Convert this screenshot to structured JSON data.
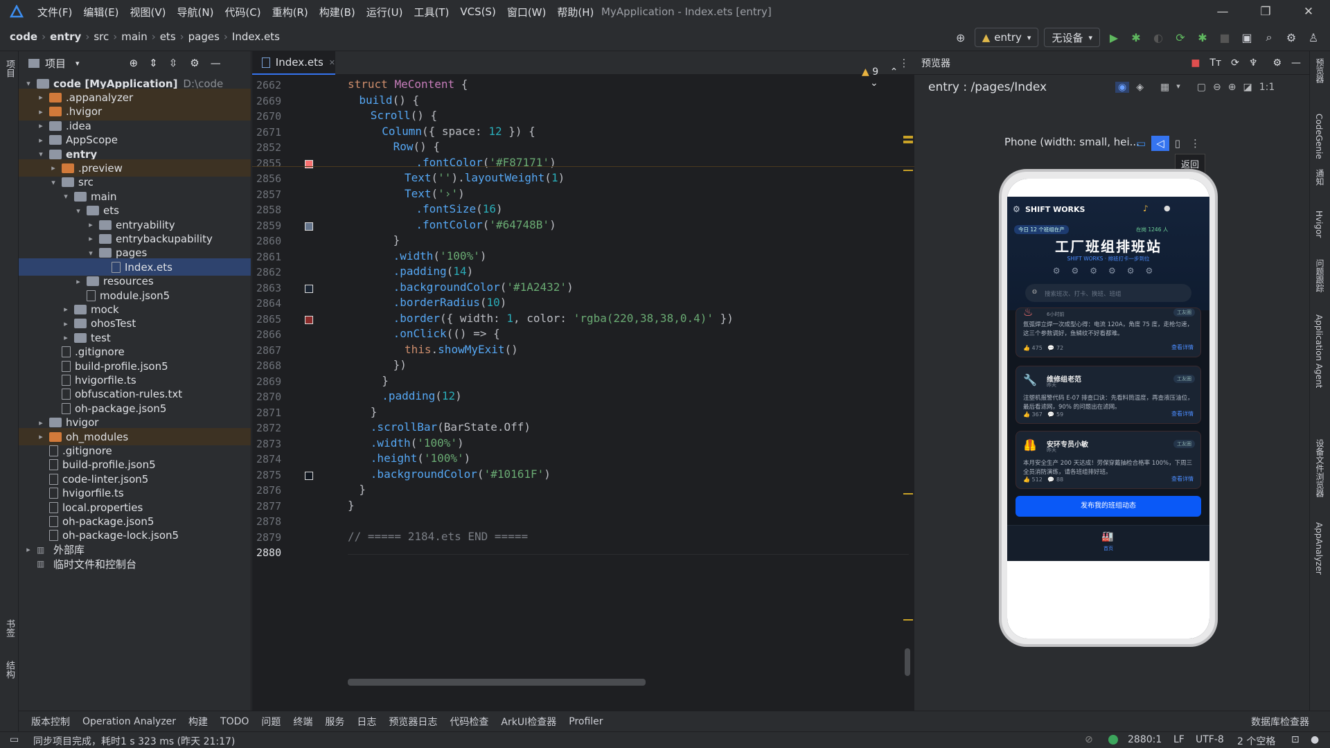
{
  "menubar": {
    "menus": [
      "文件(F)",
      "编辑(E)",
      "视图(V)",
      "导航(N)",
      "代码(C)",
      "重构(R)",
      "构建(B)",
      "运行(U)",
      "工具(T)",
      "VCS(S)",
      "窗口(W)",
      "帮助(H)"
    ],
    "title": "MyApplication - Index.ets [entry]",
    "minimize": "—",
    "maximize": "❐",
    "close": "✕"
  },
  "navbar": {
    "crumbs": [
      "code",
      "entry",
      "src",
      "main",
      "ets",
      "pages",
      "Index.ets"
    ],
    "module_select": "entry",
    "device_select": "无设备"
  },
  "leftstrip": {
    "project": "项目",
    "bookmarks": "书签",
    "structure": "结构"
  },
  "project_panel": {
    "title": "项目",
    "tree": [
      {
        "label": "code [MyApplication]",
        "extra": "D:\\code",
        "depth": 0,
        "arrow": "▾",
        "icon": "folder",
        "bold": true
      },
      {
        "label": ".appanalyzer",
        "depth": 1,
        "arrow": "▸",
        "icon": "folder-o",
        "hl": true
      },
      {
        "label": ".hvigor",
        "depth": 1,
        "arrow": "▸",
        "icon": "folder-o",
        "hl": true
      },
      {
        "label": ".idea",
        "depth": 1,
        "arrow": "▸",
        "icon": "folder"
      },
      {
        "label": "AppScope",
        "depth": 1,
        "arrow": "▸",
        "icon": "folder"
      },
      {
        "label": "entry",
        "depth": 1,
        "arrow": "▾",
        "icon": "folder",
        "bold": true
      },
      {
        "label": ".preview",
        "depth": 2,
        "arrow": "▸",
        "icon": "folder-o",
        "hl": true
      },
      {
        "label": "src",
        "depth": 2,
        "arrow": "▾",
        "icon": "folder"
      },
      {
        "label": "main",
        "depth": 3,
        "arrow": "▾",
        "icon": "folder"
      },
      {
        "label": "ets",
        "depth": 4,
        "arrow": "▾",
        "icon": "folder"
      },
      {
        "label": "entryability",
        "depth": 5,
        "arrow": "▸",
        "icon": "folder"
      },
      {
        "label": "entrybackupability",
        "depth": 5,
        "arrow": "▸",
        "icon": "folder"
      },
      {
        "label": "pages",
        "depth": 5,
        "arrow": "▾",
        "icon": "folder"
      },
      {
        "label": "Index.ets",
        "depth": 6,
        "arrow": "",
        "icon": "file",
        "sel": true
      },
      {
        "label": "resources",
        "depth": 4,
        "arrow": "▸",
        "icon": "folder"
      },
      {
        "label": "module.json5",
        "depth": 4,
        "arrow": "",
        "icon": "file"
      },
      {
        "label": "mock",
        "depth": 3,
        "arrow": "▸",
        "icon": "folder"
      },
      {
        "label": "ohosTest",
        "depth": 3,
        "arrow": "▸",
        "icon": "folder"
      },
      {
        "label": "test",
        "depth": 3,
        "arrow": "▸",
        "icon": "folder"
      },
      {
        "label": ".gitignore",
        "depth": 2,
        "arrow": "",
        "icon": "file"
      },
      {
        "label": "build-profile.json5",
        "depth": 2,
        "arrow": "",
        "icon": "file"
      },
      {
        "label": "hvigorfile.ts",
        "depth": 2,
        "arrow": "",
        "icon": "file"
      },
      {
        "label": "obfuscation-rules.txt",
        "depth": 2,
        "arrow": "",
        "icon": "file"
      },
      {
        "label": "oh-package.json5",
        "depth": 2,
        "arrow": "",
        "icon": "file"
      },
      {
        "label": "hvigor",
        "depth": 1,
        "arrow": "▸",
        "icon": "folder"
      },
      {
        "label": "oh_modules",
        "depth": 1,
        "arrow": "▸",
        "icon": "folder-o",
        "hl": true
      },
      {
        "label": ".gitignore",
        "depth": 1,
        "arrow": "",
        "icon": "file"
      },
      {
        "label": "build-profile.json5",
        "depth": 1,
        "arrow": "",
        "icon": "file"
      },
      {
        "label": "code-linter.json5",
        "depth": 1,
        "arrow": "",
        "icon": "file"
      },
      {
        "label": "hvigorfile.ts",
        "depth": 1,
        "arrow": "",
        "icon": "file"
      },
      {
        "label": "local.properties",
        "depth": 1,
        "arrow": "",
        "icon": "file"
      },
      {
        "label": "oh-package.json5",
        "depth": 1,
        "arrow": "",
        "icon": "file"
      },
      {
        "label": "oh-package-lock.json5",
        "depth": 1,
        "arrow": "",
        "icon": "file"
      },
      {
        "label": "外部库",
        "depth": 0,
        "arrow": "▸",
        "icon": "lib"
      },
      {
        "label": "临时文件和控制台",
        "depth": 0,
        "arrow": "",
        "icon": "lib"
      }
    ]
  },
  "editor": {
    "tab": "Index.ets",
    "warnings": "9",
    "lines": [
      {
        "n": "2662",
        "s": [
          [
            "struct ",
            "kw"
          ],
          [
            "MeContent ",
            "cls"
          ],
          [
            "{",
            "typ"
          ]
        ],
        "ind": 0
      },
      {
        "n": "2669",
        "s": [
          [
            "build",
            "fn"
          ],
          [
            "() {",
            "typ"
          ]
        ],
        "ind": 1
      },
      {
        "n": "2670",
        "s": [
          [
            "Scroll",
            "fn"
          ],
          [
            "() {",
            "typ"
          ]
        ],
        "ind": 2
      },
      {
        "n": "2671",
        "s": [
          [
            "Column",
            "fn"
          ],
          [
            "({ space: ",
            "typ"
          ],
          [
            "12",
            "num"
          ],
          [
            " }) {",
            "typ"
          ]
        ],
        "ind": 3
      },
      {
        "n": "2852",
        "s": [
          [
            "Row",
            "fn"
          ],
          [
            "() {",
            "typ"
          ]
        ],
        "ind": 4
      },
      {
        "n": "2855",
        "s": [
          [
            ".fontColor",
            "fn"
          ],
          [
            "(",
            "typ"
          ],
          [
            "'#F87171'",
            "str"
          ],
          [
            ")",
            "typ"
          ]
        ],
        "ind": 6,
        "sw": "#F87171"
      },
      {
        "n": "2856",
        "s": [
          [
            "Text",
            "fn"
          ],
          [
            "(",
            "typ"
          ],
          [
            "''",
            "str"
          ],
          [
            ").",
            "typ"
          ],
          [
            "layoutWeight",
            "fn"
          ],
          [
            "(",
            "typ"
          ],
          [
            "1",
            "num"
          ],
          [
            ")",
            "typ"
          ]
        ],
        "ind": 5
      },
      {
        "n": "2857",
        "s": [
          [
            "Text",
            "fn"
          ],
          [
            "(",
            "typ"
          ],
          [
            "'›'",
            "str"
          ],
          [
            ")",
            "typ"
          ]
        ],
        "ind": 5
      },
      {
        "n": "2858",
        "s": [
          [
            ".fontSize",
            "fn"
          ],
          [
            "(",
            "typ"
          ],
          [
            "16",
            "num"
          ],
          [
            ")",
            "typ"
          ]
        ],
        "ind": 6
      },
      {
        "n": "2859",
        "s": [
          [
            ".fontColor",
            "fn"
          ],
          [
            "(",
            "typ"
          ],
          [
            "'#64748B'",
            "str"
          ],
          [
            ")",
            "typ"
          ]
        ],
        "ind": 6,
        "sw": "#64748B"
      },
      {
        "n": "2860",
        "s": [
          [
            "}",
            "typ"
          ]
        ],
        "ind": 4
      },
      {
        "n": "2861",
        "s": [
          [
            ".width",
            "fn"
          ],
          [
            "(",
            "typ"
          ],
          [
            "'100%'",
            "str"
          ],
          [
            ")",
            "typ"
          ]
        ],
        "ind": 4
      },
      {
        "n": "2862",
        "s": [
          [
            ".padding",
            "fn"
          ],
          [
            "(",
            "typ"
          ],
          [
            "14",
            "num"
          ],
          [
            ")",
            "typ"
          ]
        ],
        "ind": 4
      },
      {
        "n": "2863",
        "s": [
          [
            ".backgroundColor",
            "fn"
          ],
          [
            "(",
            "typ"
          ],
          [
            "'#1A2432'",
            "str"
          ],
          [
            ")",
            "typ"
          ]
        ],
        "ind": 4,
        "sw": "#1A2432"
      },
      {
        "n": "2864",
        "s": [
          [
            ".borderRadius",
            "fn"
          ],
          [
            "(",
            "typ"
          ],
          [
            "10",
            "num"
          ],
          [
            ")",
            "typ"
          ]
        ],
        "ind": 4
      },
      {
        "n": "2865",
        "s": [
          [
            ".border",
            "fn"
          ],
          [
            "({ width: ",
            "typ"
          ],
          [
            "1",
            "num"
          ],
          [
            ", color: ",
            "typ"
          ],
          [
            "'rgba(220,38,38,0.4)'",
            "str"
          ],
          [
            " })",
            "typ"
          ]
        ],
        "ind": 4,
        "sw": "#8a2a2a"
      },
      {
        "n": "2866",
        "s": [
          [
            ".onClick",
            "fn"
          ],
          [
            "(() => {",
            "typ"
          ]
        ],
        "ind": 4
      },
      {
        "n": "2867",
        "s": [
          [
            "this",
            "kw"
          ],
          [
            ".",
            "typ"
          ],
          [
            "showMyExit",
            "fn"
          ],
          [
            "()",
            "typ"
          ]
        ],
        "ind": 5
      },
      {
        "n": "2868",
        "s": [
          [
            "})",
            "typ"
          ]
        ],
        "ind": 4
      },
      {
        "n": "2869",
        "s": [
          [
            "}",
            "typ"
          ]
        ],
        "ind": 3
      },
      {
        "n": "2870",
        "s": [
          [
            ".padding",
            "fn"
          ],
          [
            "(",
            "typ"
          ],
          [
            "12",
            "num"
          ],
          [
            ")",
            "typ"
          ]
        ],
        "ind": 3
      },
      {
        "n": "2871",
        "s": [
          [
            "}",
            "typ"
          ]
        ],
        "ind": 2
      },
      {
        "n": "2872",
        "s": [
          [
            ".scrollBar",
            "fn"
          ],
          [
            "(BarState.Off)",
            "typ"
          ]
        ],
        "ind": 2
      },
      {
        "n": "2873",
        "s": [
          [
            ".width",
            "fn"
          ],
          [
            "(",
            "typ"
          ],
          [
            "'100%'",
            "str"
          ],
          [
            ")",
            "typ"
          ]
        ],
        "ind": 2
      },
      {
        "n": "2874",
        "s": [
          [
            ".height",
            "fn"
          ],
          [
            "(",
            "typ"
          ],
          [
            "'100%'",
            "str"
          ],
          [
            ")",
            "typ"
          ]
        ],
        "ind": 2
      },
      {
        "n": "2875",
        "s": [
          [
            ".backgroundColor",
            "fn"
          ],
          [
            "(",
            "typ"
          ],
          [
            "'#10161F'",
            "str"
          ],
          [
            ")",
            "typ"
          ]
        ],
        "ind": 2,
        "sw": "#10161F"
      },
      {
        "n": "2876",
        "s": [
          [
            "}",
            "typ"
          ]
        ],
        "ind": 1
      },
      {
        "n": "2877",
        "s": [
          [
            "}",
            "typ"
          ]
        ],
        "ind": 0
      },
      {
        "n": "2878",
        "s": [],
        "ind": 0
      },
      {
        "n": "2879",
        "s": [
          [
            "// ===== 2184.ets END =====",
            "cmt"
          ]
        ],
        "ind": 0
      },
      {
        "n": "2880",
        "s": [],
        "ind": 0
      }
    ]
  },
  "preview": {
    "title": "预览器",
    "route": "entry : /pages/Index",
    "device": "Phone (width: small, hei...",
    "back_tooltip": "返回",
    "app": {
      "brand": "SHIFT WORKS",
      "notice": "今日 12 个班组在产",
      "online": "在岗 1246 人",
      "headline": "工厂班组排班站",
      "subline": "SHIFT WORKS · 排班打卡一步到位",
      "search_placeholder": "搜索班次、打卡、换班、班组",
      "cards": [
        {
          "name": "",
          "time": "6小时前",
          "tag": "工友圈",
          "body": "氩弧焊立焊一次成型心得：电流 120A，角度 75 度，走枪匀速，这三个参数调好，鱼鳞纹不好看都难。",
          "likes": "475",
          "comments": "72",
          "more": "查看详情"
        },
        {
          "name": "维修组老范",
          "time": "昨天",
          "tag": "工友圈",
          "body": "注塑机报警代码 E-07 排查口诀：先看料筒温度，再查液压油位，最后看滤网，90% 的问题出在滤网。",
          "likes": "367",
          "comments": "59",
          "more": "查看详情"
        },
        {
          "name": "安环专员小敏",
          "time": "昨天",
          "tag": "工友圈",
          "body": "本月安全生产 200 天达成！劳保穿戴抽检合格率 100%，下周三全员消防演练，请各班组排好班。",
          "likes": "512",
          "comments": "88",
          "more": "查看详情"
        }
      ],
      "post_button": "发布我的班组动态",
      "tab_home": "首页"
    }
  },
  "rightstrip": [
    "预览器",
    "CodeGenie",
    "通知",
    "Hvigor",
    "问题跟踪",
    "Application Agent",
    "设备文件浏览器",
    "AppAnalyzer"
  ],
  "bottomtools": [
    "版本控制",
    "Operation Analyzer",
    "构建",
    "TODO",
    "问题",
    "终端",
    "服务",
    "日志",
    "预览器日志",
    "代码检查",
    "ArkUI检查器",
    "Profiler",
    "数据库检查器"
  ],
  "status": {
    "message": "同步项目完成，耗时1 s 323 ms (昨天 21:17)",
    "position": "2880:1",
    "line_sep": "LF",
    "encoding": "UTF-8",
    "indent": "2 个空格"
  }
}
